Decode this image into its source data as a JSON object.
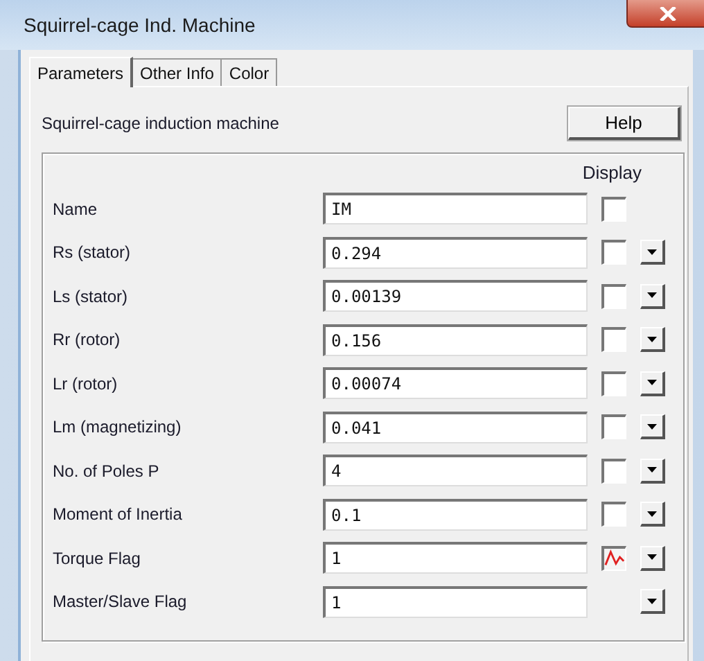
{
  "window": {
    "title": "Squirrel-cage Ind. Machine"
  },
  "tabs": [
    {
      "label": "Parameters",
      "selected": true
    },
    {
      "label": "Other Info",
      "selected": false
    },
    {
      "label": "Color",
      "selected": false
    }
  ],
  "description": "Squirrel-cage induction machine",
  "help_button": "Help",
  "display_header": "Display",
  "parameters": [
    {
      "kind": "checkbox",
      "name": "Name",
      "value": "IM",
      "checked": false,
      "menu": false
    },
    {
      "kind": "checkbox",
      "name": "Rs (stator)",
      "value": "0.294",
      "checked": false,
      "menu": true
    },
    {
      "kind": "checkbox",
      "name": "Ls (stator)",
      "value": "0.00139",
      "checked": false,
      "menu": true
    },
    {
      "kind": "checkbox",
      "name": "Rr (rotor)",
      "value": "0.156",
      "checked": false,
      "menu": true
    },
    {
      "kind": "checkbox",
      "name": "Lr (rotor)",
      "value": "0.00074",
      "checked": false,
      "menu": true
    },
    {
      "kind": "checkbox",
      "name": "Lm (magnetizing)",
      "value": "0.041",
      "checked": false,
      "menu": true
    },
    {
      "kind": "checkbox",
      "name": "No. of Poles P",
      "value": "4",
      "checked": false,
      "menu": true
    },
    {
      "kind": "checkbox",
      "name": "Moment of Inertia",
      "value": "0.1",
      "checked": false,
      "menu": true
    },
    {
      "kind": "checkbox",
      "name": "Torque Flag",
      "value": "1",
      "checked": true,
      "menu": true
    },
    {
      "kind": "plain",
      "name": "Master/Slave Flag",
      "value": "1",
      "menu": true
    }
  ]
}
